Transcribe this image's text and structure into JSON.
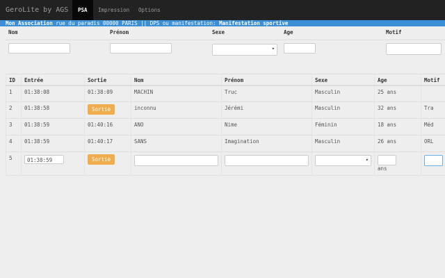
{
  "nav": {
    "brand": "GeroLite by AGS",
    "items": [
      "PSA",
      "Impression",
      "Options"
    ]
  },
  "info": {
    "association": "Mon Association",
    "address": "rue du paradis 00000 PARIS || DPS ou manifestation:",
    "event": "Manifestation sportive"
  },
  "form": {
    "labels": [
      "Nom",
      "Prénom",
      "Sexe",
      "Age",
      "Motif"
    ]
  },
  "table": {
    "headers": [
      "ID",
      "Entrée",
      "Sortie",
      "Nom",
      "Prénom",
      "Sexe",
      "Age",
      "Motif"
    ],
    "rows": [
      {
        "id": "1",
        "entree": "01:38:08",
        "sortie": "01:38:09",
        "nom": "MACHIN",
        "prenom": "Truc",
        "sexe": "Masculin",
        "age": "25 ans",
        "motif": ""
      },
      {
        "id": "2",
        "entree": "01:38:58",
        "sortie_button": "Sortie",
        "nom": "inconnu",
        "prenom": "Jérémi",
        "sexe": "Masculin",
        "age": "32 ans",
        "motif": "Tra"
      },
      {
        "id": "3",
        "entree": "01:38:59",
        "sortie": "01:40:16",
        "nom": "ANO",
        "prenom": "Nime",
        "sexe": "Féminin",
        "age": "18 ans",
        "motif": "Méd"
      },
      {
        "id": "4",
        "entree": "01:38:59",
        "sortie": "01:40:17",
        "nom": "SANS",
        "prenom": "Imagination",
        "sexe": "Masculin",
        "age": "26 ans",
        "motif": "ORL"
      }
    ],
    "new_row": {
      "id": "5",
      "entree": "01:38:59",
      "sortie_button": "Sortie",
      "age_suffix": "ans"
    }
  }
}
